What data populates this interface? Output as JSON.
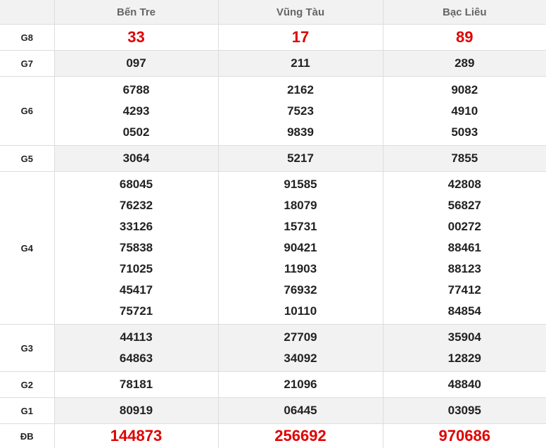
{
  "provinces": [
    "Bến Tre",
    "Vũng Tàu",
    "Bạc Liêu"
  ],
  "prizes": {
    "g8": {
      "label": "G8",
      "values": [
        [
          "33"
        ],
        [
          "17"
        ],
        [
          "89"
        ]
      ]
    },
    "g7": {
      "label": "G7",
      "values": [
        [
          "097"
        ],
        [
          "211"
        ],
        [
          "289"
        ]
      ]
    },
    "g6": {
      "label": "G6",
      "values": [
        [
          "6788",
          "4293",
          "0502"
        ],
        [
          "2162",
          "7523",
          "9839"
        ],
        [
          "9082",
          "4910",
          "5093"
        ]
      ]
    },
    "g5": {
      "label": "G5",
      "values": [
        [
          "3064"
        ],
        [
          "5217"
        ],
        [
          "7855"
        ]
      ]
    },
    "g4": {
      "label": "G4",
      "values": [
        [
          "68045",
          "76232",
          "33126",
          "75838",
          "71025",
          "45417",
          "75721"
        ],
        [
          "91585",
          "18079",
          "15731",
          "90421",
          "11903",
          "76932",
          "10110"
        ],
        [
          "42808",
          "56827",
          "00272",
          "88461",
          "88123",
          "77412",
          "84854"
        ]
      ]
    },
    "g3": {
      "label": "G3",
      "values": [
        [
          "44113",
          "64863"
        ],
        [
          "27709",
          "34092"
        ],
        [
          "35904",
          "12829"
        ]
      ]
    },
    "g2": {
      "label": "G2",
      "values": [
        [
          "78181"
        ],
        [
          "21096"
        ],
        [
          "48840"
        ]
      ]
    },
    "g1": {
      "label": "G1",
      "values": [
        [
          "80919"
        ],
        [
          "06445"
        ],
        [
          "03095"
        ]
      ]
    },
    "db": {
      "label": "ĐB",
      "values": [
        [
          "144873"
        ],
        [
          "256692"
        ],
        [
          "970686"
        ]
      ]
    }
  },
  "colors": {
    "highlight": "#e00000",
    "header_bg": "#f2f2f2",
    "border": "#dddddd",
    "text": "#222222"
  }
}
